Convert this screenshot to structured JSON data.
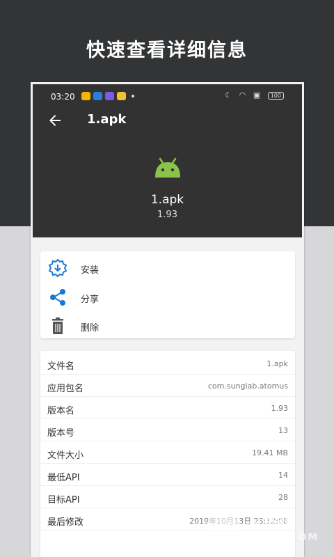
{
  "banner": {
    "title": "快速查看详细信息"
  },
  "status_bar": {
    "time": "03:20",
    "battery": "100"
  },
  "app_bar": {
    "title": "1.apk"
  },
  "file_header": {
    "name": "1.apk",
    "version": "1.93",
    "icon": "android-robot-icon"
  },
  "actions": [
    {
      "label": "安装",
      "icon": "install-icon"
    },
    {
      "label": "分享",
      "icon": "share-icon"
    },
    {
      "label": "删除",
      "icon": "delete-icon"
    }
  ],
  "details": [
    {
      "key": "文件名",
      "value": "1.apk"
    },
    {
      "key": "应用包名",
      "value": "com.sunglab.atomus"
    },
    {
      "key": "版本名",
      "value": "1.93"
    },
    {
      "key": "版本号",
      "value": "13"
    },
    {
      "key": "文件大小",
      "value": "19.41 MB"
    },
    {
      "key": "最低API",
      "value": "14"
    },
    {
      "key": "目标API",
      "value": "28"
    },
    {
      "key": "最后修改",
      "value": "2019年10月13日 23:12:08"
    }
  ],
  "watermark": {
    "name": "一游戏",
    "domain": "YIXUI.COM"
  },
  "colors": {
    "accent": "#1976d2",
    "android_green": "#8bc34a",
    "dark_bg": "#333436",
    "appbar": "#323232"
  }
}
